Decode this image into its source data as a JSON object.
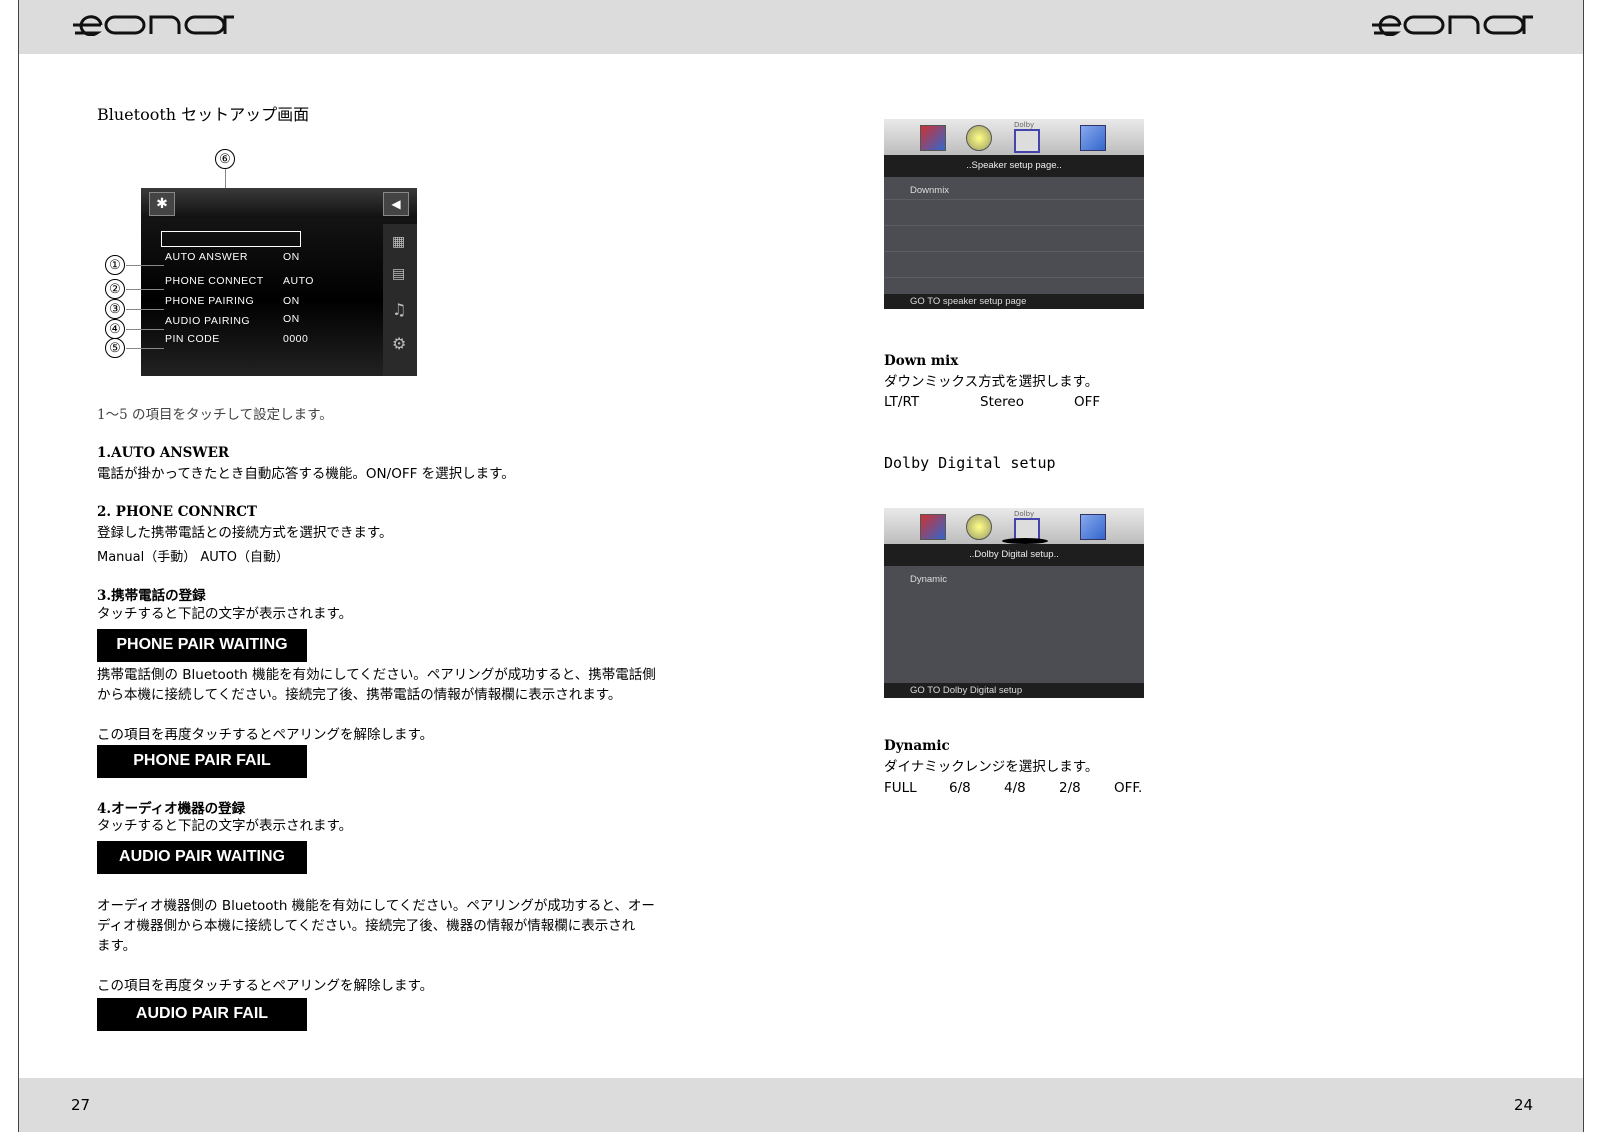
{
  "left_page": {
    "brand": "eonon",
    "page_number": "27",
    "title": "Bluetooth セットアップ画面",
    "bt_screen": {
      "callout_top": "⑥",
      "rows": [
        {
          "num": "①",
          "label": "AUTO    ANSWER",
          "value": "ON"
        },
        {
          "num": "②",
          "label": "PHONE  CONNECT",
          "value": "AUTO"
        },
        {
          "num": "③",
          "label": "PHONE  PAIRING",
          "value": "ON"
        },
        {
          "num": "④",
          "label": "AUDIO   PAIRING",
          "value": "ON"
        },
        {
          "num": "⑤",
          "label": "PIN   CODE",
          "value": "0000"
        }
      ]
    },
    "intro": "1～5 の項目をタッチして設定します。",
    "s1_heading": "1.AUTO   ANSWER",
    "s1_text": "電話が掛かってきたとき自動応答する機能。ON/OFF を選択します。",
    "s2_heading": "2. PHONE CONNRCT",
    "s2_text": "登録した携帯電話との接続方式を選択できます。",
    "s2_options": "Manual（手動）     AUTO（自動）",
    "s3_heading": "3.携帯電話の登録",
    "s3_text": "タッチすると下記の文字が表示されます。",
    "badge_phone_wait": "PHONE PAIR WAITING",
    "s3_para1": "携帯電話側の Bluetooth 機能を有効にしてください。ペアリングが成功すると、携帯電話側",
    "s3_para2": "から本機に接続してください。接続完了後、携帯電話の情報が情報欄に表示されます。",
    "s3_release": "この項目を再度タッチするとペアリングを解除します。",
    "badge_phone_fail": "PHONE PAIR FAIL",
    "s4_heading": "4.オーディオ機器の登録",
    "s4_text": "タッチすると下記の文字が表示されます。",
    "badge_audio_wait": "AUDIO PAIR WAITING",
    "s4_para1": "オーディオ機器側の Bluetooth 機能を有効にしてください。ペアリングが成功すると、オー",
    "s4_para2": "ディオ機器側から本機に接続してください。接続完了後、機器の情報が情報欄に表示され",
    "s4_para3": "ます。",
    "s4_release": "この項目を再度タッチするとペアリングを解除します。",
    "badge_audio_fail": "AUDIO PAIR FAIL"
  },
  "right_page": {
    "brand": "eonon",
    "page_number": "24",
    "speaker_screen": {
      "icon_label": "Dolby",
      "title": "..Speaker setup page..",
      "item": "Downmix",
      "footer": "GO TO speaker setup page"
    },
    "downmix_heading": "Down mix",
    "downmix_text": "ダウンミックス方式を選択します。",
    "downmix_options": [
      "LT/RT",
      "Stereo",
      "OFF"
    ],
    "dolby_heading": "Dolby Digital setup",
    "dolby_screen": {
      "icon_label": "Dolby",
      "title": "..Dolby Digital setup..",
      "item": "Dynamic",
      "footer": "GO TO Dolby Digital setup"
    },
    "dynamic_heading": "Dynamic",
    "dynamic_text": "ダイナミックレンジを選択します。",
    "dynamic_options": [
      "FULL",
      "6/8",
      "4/8",
      "2/8",
      "OFF."
    ]
  }
}
